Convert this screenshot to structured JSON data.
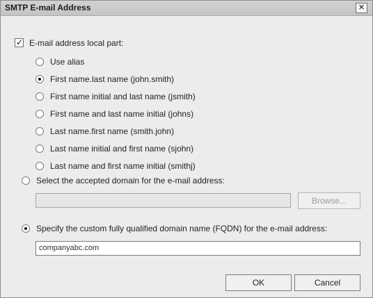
{
  "window": {
    "title": "SMTP E-mail Address"
  },
  "local_part": {
    "label": "E-mail address local part:",
    "checked": true
  },
  "local_part_options": [
    {
      "label": "Use alias",
      "selected": false
    },
    {
      "label": "First name.last name (john.smith)",
      "selected": true
    },
    {
      "label": "First name initial and last name (jsmith)",
      "selected": false
    },
    {
      "label": "First name and last name initial (johns)",
      "selected": false
    },
    {
      "label": "Last name.first name (smith.john)",
      "selected": false
    },
    {
      "label": "Last name initial and first name (sjohn)",
      "selected": false
    },
    {
      "label": "Last name and first name initial (smithj)",
      "selected": false
    }
  ],
  "accepted_domain": {
    "label": "Select the accepted domain for the e-mail address:",
    "selected": false,
    "value": "",
    "browse_label": "Browse..."
  },
  "custom_fqdn": {
    "label": "Specify the custom fully qualified domain name (FQDN) for the e-mail address:",
    "selected": true,
    "value": "companyabc.com"
  },
  "buttons": {
    "ok": "OK",
    "cancel": "Cancel"
  }
}
